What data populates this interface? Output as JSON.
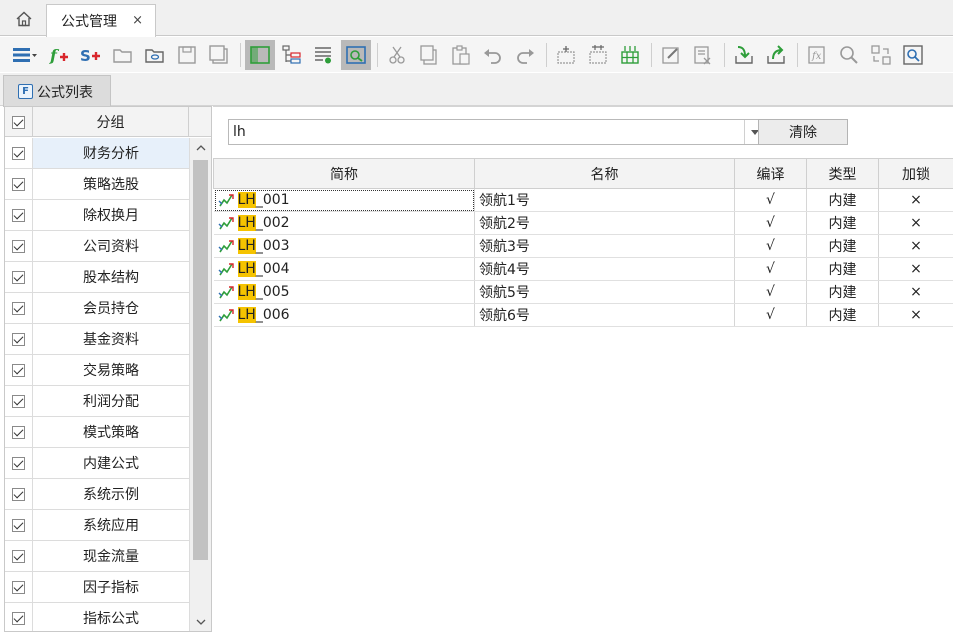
{
  "tabs": {
    "document_tab": "公式管理",
    "close_symbol": "×"
  },
  "toolbar": {
    "icons": [
      "menu-icon",
      "add-formula-icon",
      "add-strategy-icon",
      "open-folder-icon",
      "link-folder-icon",
      "save-icon",
      "save-as-icon",
      "panel-view-icon",
      "tree-view-icon",
      "list-view-icon",
      "preview-icon",
      "cut-icon",
      "copy-icon",
      "paste-icon",
      "undo-icon",
      "redo-icon",
      "insert-row-icon",
      "insert-col-icon",
      "grid-icon",
      "edit-icon",
      "delete-icon",
      "import-icon",
      "export-icon",
      "formula-test-icon",
      "search-icon",
      "replace-icon",
      "find-icon"
    ]
  },
  "panel": {
    "tab_label": "公式列表",
    "tab_icon_letter": "F"
  },
  "groups": {
    "header": "分组",
    "items": [
      {
        "label": "财务分析",
        "checked": true,
        "selected": true
      },
      {
        "label": "策略选股",
        "checked": true
      },
      {
        "label": "除权换月",
        "checked": true
      },
      {
        "label": "公司资料",
        "checked": true
      },
      {
        "label": "股本结构",
        "checked": true
      },
      {
        "label": "会员持仓",
        "checked": true
      },
      {
        "label": "基金资料",
        "checked": true
      },
      {
        "label": "交易策略",
        "checked": true
      },
      {
        "label": "利润分配",
        "checked": true
      },
      {
        "label": "模式策略",
        "checked": true
      },
      {
        "label": "内建公式",
        "checked": true
      },
      {
        "label": "系统示例",
        "checked": true
      },
      {
        "label": "系统应用",
        "checked": true
      },
      {
        "label": "现金流量",
        "checked": true
      },
      {
        "label": "因子指标",
        "checked": true
      },
      {
        "label": "指标公式",
        "checked": true
      }
    ]
  },
  "filter": {
    "value": "lh",
    "clear_label": "清除"
  },
  "table": {
    "columns": [
      "简称",
      "名称",
      "编译",
      "类型",
      "加锁"
    ],
    "rows": [
      {
        "highlight": "LH",
        "suffix": "_001",
        "name": "领航1号",
        "compiled": "√",
        "type": "内建",
        "locked": "×"
      },
      {
        "highlight": "LH",
        "suffix": "_002",
        "name": "领航2号",
        "compiled": "√",
        "type": "内建",
        "locked": "×"
      },
      {
        "highlight": "LH",
        "suffix": "_003",
        "name": "领航3号",
        "compiled": "√",
        "type": "内建",
        "locked": "×"
      },
      {
        "highlight": "LH",
        "suffix": "_004",
        "name": "领航4号",
        "compiled": "√",
        "type": "内建",
        "locked": "×"
      },
      {
        "highlight": "LH",
        "suffix": "_005",
        "name": "领航5号",
        "compiled": "√",
        "type": "内建",
        "locked": "×"
      },
      {
        "highlight": "LH",
        "suffix": "_006",
        "name": "领航6号",
        "compiled": "√",
        "type": "内建",
        "locked": "×"
      }
    ]
  },
  "colors": {
    "highlight": "#f5c300",
    "selected_row": "#e7f0fa",
    "accent_green": "#2e9e3a",
    "accent_red": "#d9262c",
    "accent_blue": "#2f6fb2"
  }
}
